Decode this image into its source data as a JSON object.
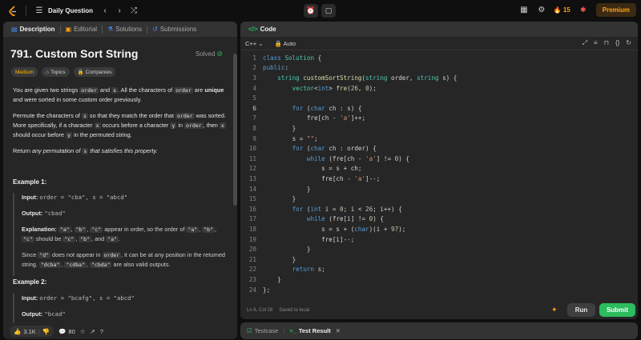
{
  "topbar": {
    "title": "Daily Question",
    "streak": "15",
    "premium": "Premium"
  },
  "left": {
    "tabs": [
      {
        "label": "Description"
      },
      {
        "label": "Editorial"
      },
      {
        "label": "Solutions"
      },
      {
        "label": "Submissions"
      }
    ],
    "problem_title": "791. Custom Sort String",
    "status": "Solved",
    "chips": [
      "Medium",
      "Topics",
      "Companies"
    ],
    "p1_a": "You are given two strings ",
    "p1_code1": "order",
    "p1_b": " and ",
    "p1_code2": "s",
    "p1_c": ". All the characters of ",
    "p1_code3": "order",
    "p1_d": " are ",
    "p1_e": "unique",
    "p1_f": " and were sorted in some custom order previously.",
    "p2_a": "Permute the characters of ",
    "p2_code1": "s",
    "p2_b": " so that they match the order that ",
    "p2_code2": "order",
    "p2_c": " was sorted. More specifically, if a character ",
    "p2_code3": "x",
    "p2_d": " occurs before a character ",
    "p2_code4": "y",
    "p2_e": " in ",
    "p2_code5": "order",
    "p2_f": ", then ",
    "p2_code6": "x",
    "p2_g": " should occur before ",
    "p2_code7": "y",
    "p2_h": " in the permuted string.",
    "p3_a": "Return ",
    "p3_b": "any permutation of ",
    "p3_code": "s",
    "p3_c": " that satisfies this property.",
    "ex1_title": "Example 1:",
    "ex1_input_label": "Input:",
    "ex1_input": "order = \"cba\", s = \"abcd\"",
    "ex1_output_label": "Output:",
    "ex1_output": "\"cbad\"",
    "ex1_expl_label": "Explanation:",
    "ex1_expl_code1": "\"a\"",
    "ex1_expl_code2": "\"b\"",
    "ex1_expl_code3": "\"c\"",
    "ex1_expl_mid": " appear in order, so the order of ",
    "ex1_expl_code4": "\"a\"",
    "ex1_expl_code5": "\"b\"",
    "ex1_expl_code6": "\"c\"",
    "ex1_expl_mid2": " should be ",
    "ex1_expl_code7": "\"c\"",
    "ex1_expl_code8": "\"b\"",
    "ex1_expl_and": ", and ",
    "ex1_expl_code9": "\"a\"",
    "ex1_since_a": "Since ",
    "ex1_since_code1": "\"d\"",
    "ex1_since_b": " does not appear in ",
    "ex1_since_code2": "order",
    "ex1_since_c": ", it can be at any position in the returned string. ",
    "ex1_since_code3": "\"dcba\"",
    "ex1_since_code4": "\"cdba\"",
    "ex1_since_code5": "\"cbda\"",
    "ex1_since_d": " are also valid outputs.",
    "ex2_title": "Example 2:",
    "ex2_input_label": "Input:",
    "ex2_input": "order = \"bcafg\", s = \"abcd\"",
    "ex2_output_label": "Output:",
    "ex2_output": "\"bcad\"",
    "likes": "3.1K",
    "comments": "80"
  },
  "code": {
    "tab_label": "Code",
    "language": "C++",
    "mode": "Auto",
    "status_pos": "Ln 6, Col 28",
    "status_saved": "Saved to local",
    "run": "Run",
    "submit": "Submit"
  },
  "bottom": {
    "tabs": [
      "Testcase",
      "Test Result"
    ]
  },
  "colors": {
    "accent": "#ffa116",
    "submit": "#2cbb5d",
    "keyword": "#569cd6",
    "type": "#4ec9b0",
    "function": "#dcdcaa",
    "string": "#ce9178",
    "number": "#b5cea8"
  }
}
